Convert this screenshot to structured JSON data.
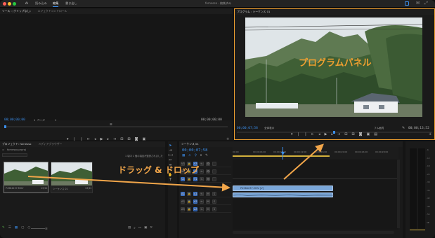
{
  "titlebar": {
    "title": "fornesso - 編集済み",
    "tabs": [
      "読み込み",
      "編集",
      "書き出し"
    ]
  },
  "source": {
    "tabs": [
      "ソース : (クリップなし)",
      "エフェクトコントロール"
    ],
    "timecode_left": "00;00;00;00",
    "fit": "1 ページ",
    "fraction": "1",
    "timecode_right": "00;00;00;00"
  },
  "program": {
    "tab": "プログラム : シーケンス 01",
    "timecode_left": "00;00;07;58",
    "fit": "全体表示",
    "quality": "フル画質",
    "timecode_right": "00;00;13;52",
    "overlay_text": "プログラムパネル",
    "accent": "#f0a030"
  },
  "project": {
    "tabs": [
      "プロジェクト: fornesso",
      "メディアブラウザー"
    ],
    "file": "fornesso.prproj",
    "selection_info": "1 項中 1 個の項目が選択されました",
    "items": [
      {
        "name": "P4984237.MOV",
        "duration": "13;52"
      },
      {
        "name": "シーケンス 01",
        "duration": "13;52"
      }
    ]
  },
  "timeline": {
    "tab": "シーケンス 01",
    "timecode": "00;00;07;58",
    "ruler_labels": [
      "00;00",
      "00;00;04;00",
      "00;00;08;00",
      "00;00;12;00",
      "00;00;16;00",
      "00;00;20;00",
      "00;00;24;00",
      "00;00;28;00"
    ],
    "tracks": [
      "V3",
      "V2",
      "V1",
      "A1",
      "A2",
      "A3"
    ],
    "clip_label": "P4984237.MOV [V]"
  },
  "annotation": {
    "drag_text": "ドラッグ & ドロップ",
    "arrow_color": "#f2a64a"
  },
  "meter": {
    "labels": [
      "-6",
      "-12",
      "-18",
      "-24",
      "-30",
      "-36",
      "-42",
      "-48",
      "-54",
      "dB"
    ]
  }
}
